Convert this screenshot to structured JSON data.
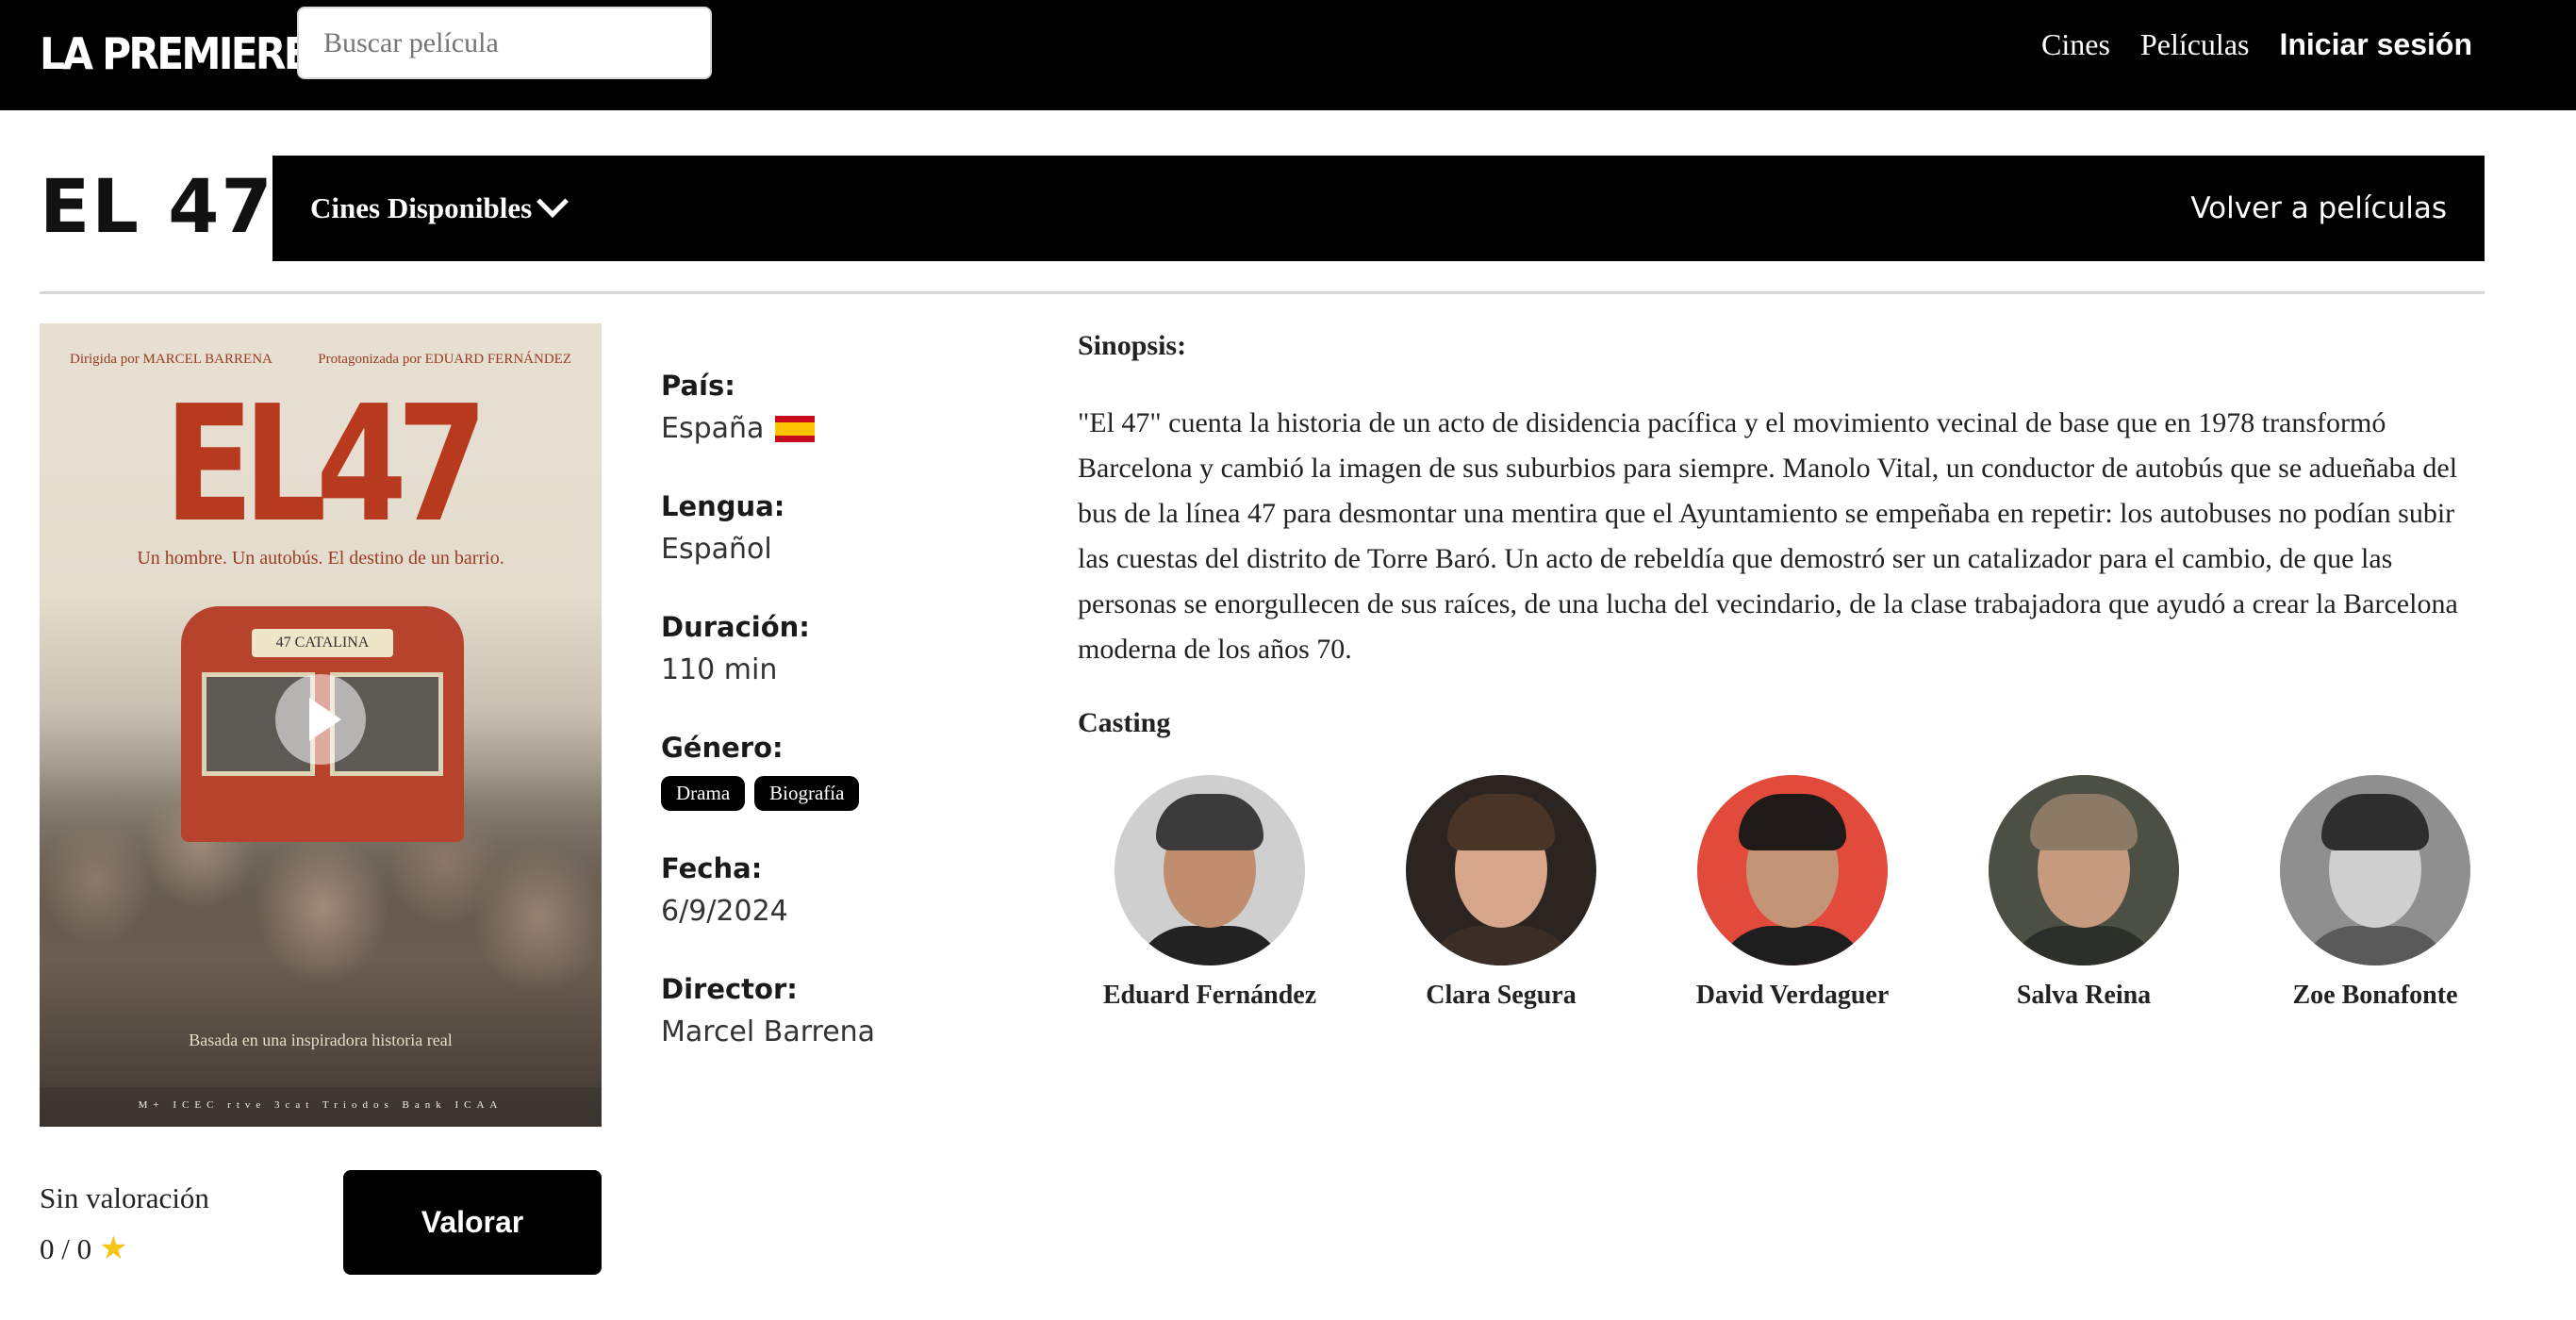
{
  "nav": {
    "logo": "LA PREMIERE",
    "search_placeholder": "Buscar película",
    "links": [
      "Cines",
      "Películas",
      "Iniciar sesión"
    ]
  },
  "movie": {
    "title": "EL 47",
    "cines_label": "Cines Disponibles",
    "back_label": "Volver a películas"
  },
  "poster": {
    "credit_left": "Dirigida por MARCEL BARRENA",
    "credit_right": "Protagonizada por EDUARD FERNÁNDEZ",
    "big_title": "EL47",
    "tagline": "Un hombre. Un autobús. El destino de un barrio.",
    "bus_sign": "47 CATALINA",
    "footer": "Basada en una inspiradora historia real",
    "logos": "M+ ICEC rtve 3cat Triodos Bank ICAA",
    "icon": "play-icon"
  },
  "rating": {
    "label": "Sin valoración",
    "value": "0 / 0",
    "icon": "star-icon",
    "button": "Valorar"
  },
  "info": {
    "pais_label": "País:",
    "pais_value": "España",
    "lengua_label": "Lengua:",
    "lengua_value": "Español",
    "duracion_label": "Duración:",
    "duracion_value": "110 min",
    "genero_label": "Género:",
    "genres": [
      "Drama",
      "Biografía"
    ],
    "fecha_label": "Fecha:",
    "fecha_value": "6/9/2024",
    "director_label": "Director:",
    "director_value": "Marcel Barrena"
  },
  "synopsis": {
    "title": "Sinopsis:",
    "text": "\"El 47\" cuenta la historia de un acto de disidencia pacífica y el movimiento vecinal de base que en 1978 transformó Barcelona y cambió la imagen de sus suburbios para siempre. Manolo Vital, un conductor de autobús que se adueñaba del bus de la línea 47 para desmontar una mentira que el Ayuntamiento se empeñaba en repetir: los autobuses no podían subir las cuestas del distrito de Torre Baró. Un acto de rebeldía que demostró ser un catalizador para el cambio, de que las personas se enorgullecen de sus raíces, de una lucha del vecindario, de la clase trabajadora que ayudó a crear la Barcelona moderna de los años 70."
  },
  "casting": {
    "title": "Casting",
    "members": [
      {
        "name": "Eduard Fernández"
      },
      {
        "name": "Clara Segura"
      },
      {
        "name": "David Verdaguer"
      },
      {
        "name": "Salva Reina"
      },
      {
        "name": "Zoe Bonafonte"
      }
    ]
  },
  "colors": {
    "nav_bg": "#000000",
    "button_bg": "#000000",
    "star": "#f5c518",
    "poster_red": "#b73a1f"
  }
}
